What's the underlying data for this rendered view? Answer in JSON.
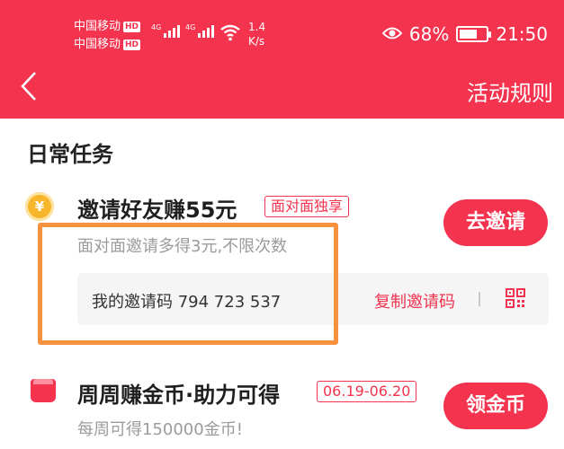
{
  "status_bar": {
    "carrier1": "中国移动",
    "carrier2": "中国移动",
    "hd": "HD",
    "network": "4G",
    "speed_value": "1.4",
    "speed_unit": "K/s",
    "battery": "68%",
    "battery_level": 0.68,
    "time": "21:50"
  },
  "nav": {
    "back_icon": "chevron-left-icon",
    "rules_label": "活动规则"
  },
  "section": {
    "title": "日常任务"
  },
  "tasks": [
    {
      "icon": "coin-yuan-icon",
      "icon_glyph": "¥",
      "title": "邀请好友赚55元",
      "tag": "面对面独享",
      "subtitle": "面对面邀请多得3元,不限次数",
      "button": "去邀请",
      "invite_label": "我的邀请码 794 723 537",
      "copy_label": "复制邀请码",
      "qr_icon": "qr-code-icon"
    },
    {
      "icon": "red-bag-icon",
      "title": "周周赚金币·助力可得",
      "tag": "06.19-06.20",
      "subtitle": "每周可得150000金币!",
      "button": "领金币"
    }
  ],
  "colors": {
    "brand": "#f4334f",
    "highlight": "#f7913d"
  }
}
